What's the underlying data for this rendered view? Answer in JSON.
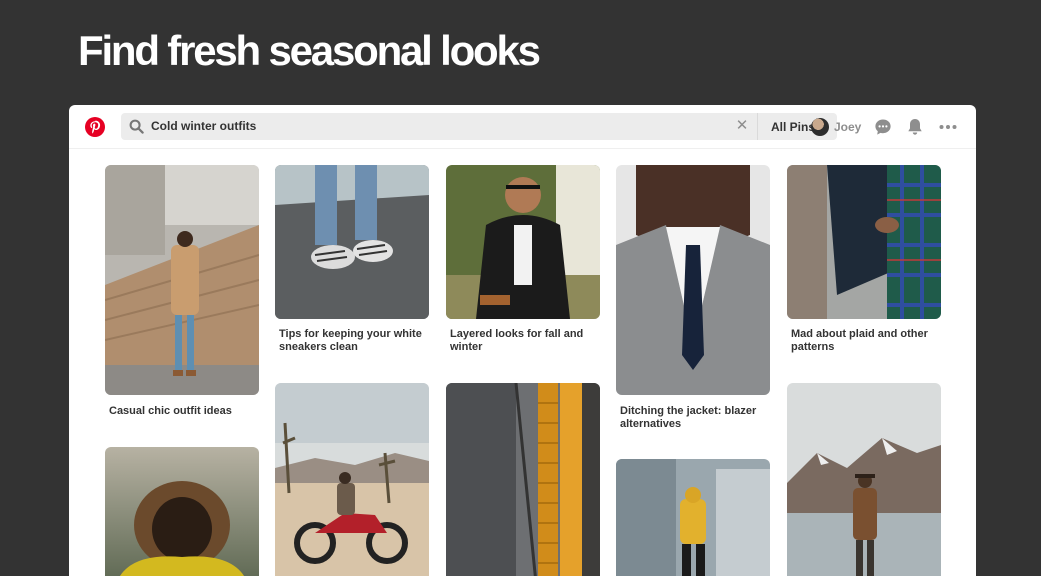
{
  "headline": "Find fresh seasonal looks",
  "search": {
    "query": "Cold winter outfits",
    "clear_glyph": "✕",
    "filter_label": "All Pins"
  },
  "user": {
    "name": "Joey"
  },
  "icons": {
    "logo": "pinterest-logo-icon",
    "search": "search-icon",
    "messages": "chat-bubble-icon",
    "notifications": "bell-icon",
    "more": "more-dots-icon"
  },
  "colors": {
    "brand": "#e60023",
    "page_bg": "#333333",
    "search_bg": "#ececec"
  },
  "pins": [
    {
      "caption": "Casual chic outfit ideas"
    },
    {
      "caption": "Tips for keeping your white sneakers clean"
    },
    {
      "caption": "Layered looks for fall and winter"
    },
    {
      "caption": "Ditching the jacket: blazer alternatives"
    },
    {
      "caption": "Mad about plaid and other patterns"
    }
  ]
}
